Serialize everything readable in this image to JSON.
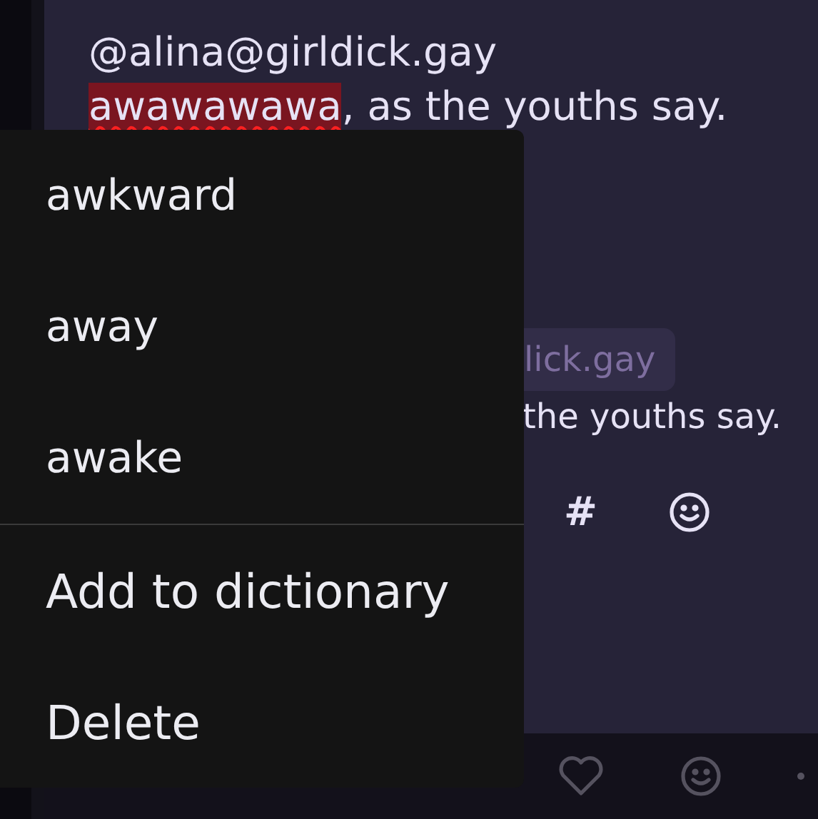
{
  "compose": {
    "mention": "@alina@girldick.gay",
    "misspelled": "awawawawa",
    "rest": ", as the youths say."
  },
  "preview": {
    "mention": "lick.gay",
    "text": "the youths say."
  },
  "toolbar": [
    {
      "kind": "hashtag",
      "label": "#"
    },
    {
      "kind": "emoji"
    }
  ],
  "bottom_bar": [
    {
      "kind": "like"
    },
    {
      "kind": "emoji"
    },
    {
      "kind": "more"
    }
  ],
  "context_menu": {
    "suggestions": [
      "awkward",
      "away",
      "awake"
    ],
    "actions": [
      "Add to dictionary",
      "Delete"
    ]
  }
}
